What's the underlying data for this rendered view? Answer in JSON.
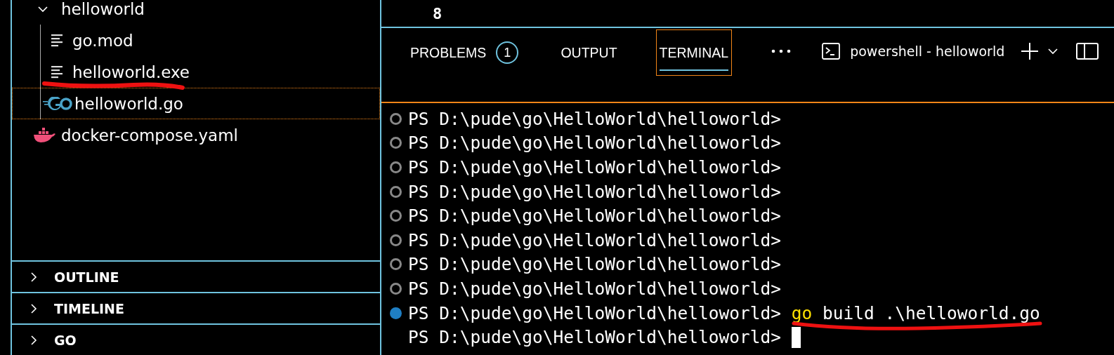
{
  "explorer": {
    "folder": {
      "name": "helloworld",
      "expanded": true,
      "children": [
        {
          "name": "go.mod",
          "kind": "text",
          "selected": false
        },
        {
          "name": "helloworld.exe",
          "kind": "text",
          "selected": false
        },
        {
          "name": "helloworld.go",
          "kind": "go",
          "selected": true
        }
      ]
    },
    "files": [
      {
        "name": "docker-compose.yaml",
        "kind": "docker",
        "selected": false
      }
    ],
    "sections": [
      {
        "title": "OUTLINE",
        "expanded": false
      },
      {
        "title": "TIMELINE",
        "expanded": false
      },
      {
        "title": "GO",
        "expanded": false
      }
    ]
  },
  "editor": {
    "line_number": "8"
  },
  "panel": {
    "tabs": [
      {
        "label": "PROBLEMS",
        "selected": false,
        "badge": "1"
      },
      {
        "label": "OUTPUT",
        "selected": false
      },
      {
        "label": "TERMINAL",
        "selected": true
      }
    ],
    "terminal_name": "powershell - helloworld"
  },
  "terminal": {
    "lines": [
      {
        "prompt": "PS D:\\pude\\go\\HelloWorld\\helloworld>",
        "decorated": true,
        "succeeded": false
      },
      {
        "prompt": "PS D:\\pude\\go\\HelloWorld\\helloworld>",
        "decorated": true,
        "succeeded": false
      },
      {
        "prompt": "PS D:\\pude\\go\\HelloWorld\\helloworld>",
        "decorated": true,
        "succeeded": false
      },
      {
        "prompt": "PS D:\\pude\\go\\HelloWorld\\helloworld>",
        "decorated": true,
        "succeeded": false
      },
      {
        "prompt": "PS D:\\pude\\go\\HelloWorld\\helloworld>",
        "decorated": true,
        "succeeded": false
      },
      {
        "prompt": "PS D:\\pude\\go\\HelloWorld\\helloworld>",
        "decorated": true,
        "succeeded": false
      },
      {
        "prompt": "PS D:\\pude\\go\\HelloWorld\\helloworld>",
        "decorated": true,
        "succeeded": false
      },
      {
        "prompt": "PS D:\\pude\\go\\HelloWorld\\helloworld>",
        "decorated": true,
        "succeeded": false
      },
      {
        "prompt": "PS D:\\pude\\go\\HelloWorld\\helloworld>",
        "decorated": true,
        "succeeded": true,
        "command": [
          {
            "text": "go",
            "kind": "keyword"
          },
          {
            "text": "build .\\helloworld.go",
            "kind": "plain"
          }
        ]
      },
      {
        "prompt": "PS D:\\pude\\go\\HelloWorld\\helloworld>",
        "decorated": false,
        "cursor": true
      }
    ]
  }
}
